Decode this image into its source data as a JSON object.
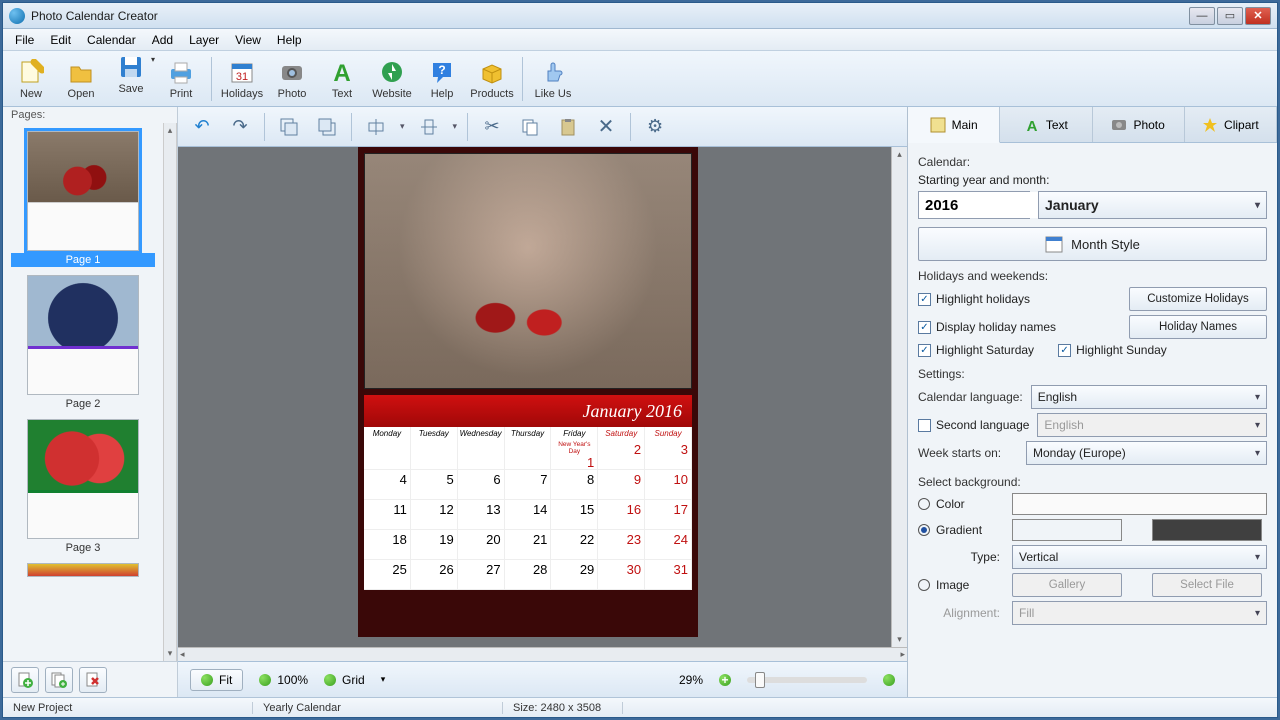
{
  "app": {
    "title": "Photo Calendar Creator"
  },
  "menu": {
    "items": [
      "File",
      "Edit",
      "Calendar",
      "Add",
      "Layer",
      "View",
      "Help"
    ]
  },
  "toolbar": {
    "items": [
      {
        "label": "New",
        "icon": "new"
      },
      {
        "label": "Open",
        "icon": "open"
      },
      {
        "label": "Save",
        "icon": "save",
        "split": true
      },
      {
        "label": "Print",
        "icon": "print"
      },
      {
        "sep": true
      },
      {
        "label": "Holidays",
        "icon": "holidays"
      },
      {
        "label": "Photo",
        "icon": "photo"
      },
      {
        "label": "Text",
        "icon": "text"
      },
      {
        "label": "Website",
        "icon": "website"
      },
      {
        "label": "Help",
        "icon": "help"
      },
      {
        "label": "Products",
        "icon": "products"
      },
      {
        "sep": true
      },
      {
        "label": "Like Us",
        "icon": "like"
      }
    ]
  },
  "pages": {
    "label": "Pages:",
    "items": [
      {
        "label": "Page 1",
        "selected": true,
        "img": "cherries",
        "accent": "#c01010"
      },
      {
        "label": "Page 2",
        "img": "blueberries",
        "accent": "#7030d0"
      },
      {
        "label": "Page 3",
        "img": "watermelon",
        "accent": "#108030"
      }
    ]
  },
  "canvas": {
    "month_title": "January 2016",
    "dow": [
      "Monday",
      "Tuesday",
      "Wednesday",
      "Thursday",
      "Friday",
      "Saturday",
      "Sunday"
    ],
    "holiday_note": "New Year's Day",
    "weeks": [
      [
        "",
        "",
        "",
        "",
        "",
        "1",
        "2",
        "3"
      ],
      [
        "4",
        "5",
        "6",
        "7",
        "8",
        "9",
        "10"
      ],
      [
        "11",
        "12",
        "13",
        "14",
        "15",
        "16",
        "17"
      ],
      [
        "18",
        "19",
        "20",
        "21",
        "22",
        "23",
        "24"
      ],
      [
        "25",
        "26",
        "27",
        "28",
        "29",
        "30",
        "31"
      ]
    ]
  },
  "bottom": {
    "fit": "Fit",
    "zoom": "100%",
    "grid": "Grid",
    "current_zoom": "29%"
  },
  "panel": {
    "tabs": {
      "main": "Main",
      "text": "Text",
      "photo": "Photo",
      "clipart": "Clipart"
    },
    "calendar_label": "Calendar:",
    "starting_label": "Starting year and month:",
    "year": "2016",
    "month": "January",
    "month_style_btn": "Month Style",
    "holidays_label": "Holidays and weekends:",
    "highlight_holidays": "Highlight holidays",
    "customize_btn": "Customize Holidays",
    "display_holiday_names": "Display holiday names",
    "holiday_names_btn": "Holiday Names",
    "highlight_saturday": "Highlight Saturday",
    "highlight_sunday": "Highlight Sunday",
    "settings_label": "Settings:",
    "language_label": "Calendar language:",
    "language_value": "English",
    "second_lang_label": "Second language",
    "second_lang_value": "English",
    "week_starts_label": "Week starts on:",
    "week_starts_value": "Monday (Europe)",
    "bg_label": "Select background:",
    "bg_color": "Color",
    "bg_gradient": "Gradient",
    "bg_type_label": "Type:",
    "bg_type_value": "Vertical",
    "bg_image": "Image",
    "gallery_btn": "Gallery",
    "select_file_btn": "Select File",
    "alignment_label": "Alignment:",
    "alignment_value": "Fill",
    "grad_color1": "#4a0808",
    "grad_color2": "#404040"
  },
  "status": {
    "project": "New Project",
    "type": "Yearly Calendar",
    "size": "Size: 2480 x 3508"
  }
}
